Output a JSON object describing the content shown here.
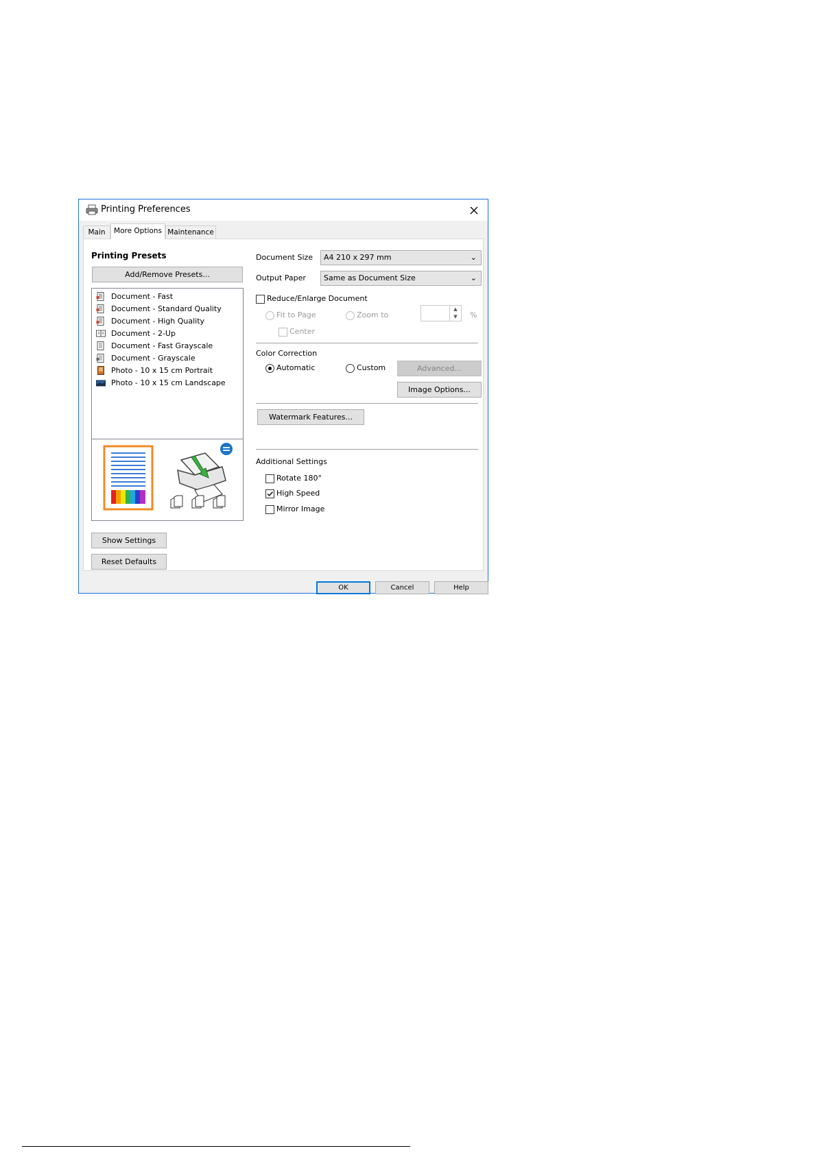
{
  "window": {
    "title": "Printing Preferences"
  },
  "tabs": [
    {
      "label": "Main"
    },
    {
      "label": "More Options"
    },
    {
      "label": "Maintenance"
    }
  ],
  "presets": {
    "title": "Printing Presets",
    "add_remove_label": "Add/Remove Presets...",
    "items": [
      {
        "label": "Document - Fast",
        "icon": "document-icon"
      },
      {
        "label": "Document - Standard Quality",
        "icon": "document-icon"
      },
      {
        "label": "Document - High Quality",
        "icon": "document-icon"
      },
      {
        "label": "Document - 2-Up",
        "icon": "two-up-icon"
      },
      {
        "label": "Document - Fast Grayscale",
        "icon": "grayscale-document-icon"
      },
      {
        "label": "Document - Grayscale",
        "icon": "grayscale-document-icon"
      },
      {
        "label": "Photo - 10 x 15 cm Portrait",
        "icon": "photo-portrait-icon"
      },
      {
        "label": "Photo - 10 x 15 cm Landscape",
        "icon": "photo-landscape-icon"
      }
    ]
  },
  "left_buttons": {
    "show_settings": "Show Settings",
    "reset_defaults": "Reset Defaults"
  },
  "document_size": {
    "label": "Document Size",
    "value": "A4 210 x 297 mm"
  },
  "output_paper": {
    "label": "Output Paper",
    "value": "Same as Document Size"
  },
  "reduce_enlarge": {
    "label": "Reduce/Enlarge Document",
    "checked": false,
    "fit_to_page": "Fit to Page",
    "zoom_to": "Zoom to",
    "center": "Center",
    "percent": "%"
  },
  "color_correction": {
    "title": "Color Correction",
    "automatic": "Automatic",
    "custom": "Custom",
    "advanced": "Advanced...",
    "image_options": "Image Options..."
  },
  "watermark": {
    "label": "Watermark Features..."
  },
  "additional_settings": {
    "title": "Additional Settings",
    "rotate": "Rotate 180°",
    "high_speed": "High Speed",
    "mirror": "Mirror Image"
  },
  "footer": {
    "ok": "OK",
    "cancel": "Cancel",
    "help": "Help"
  },
  "colors": {
    "window_border": "#1e6fd9",
    "default_button_border": "#0078d7",
    "arrow_green": "#3cb043",
    "badge_blue": "#1a73c9"
  }
}
